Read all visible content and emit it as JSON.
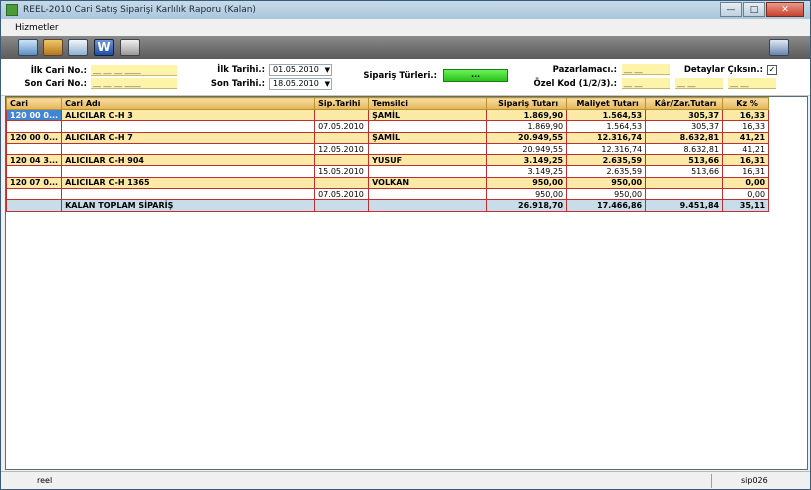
{
  "window": {
    "title": "REEL-2010 Cari Satış Siparişi Karlılık Raporu (Kalan)"
  },
  "menu": {
    "items": [
      "Hizmetler"
    ]
  },
  "toolbar": {
    "icons": [
      "monitor-icon",
      "notebook-icon",
      "mail-icon",
      "word-icon",
      "printer-icon",
      "exit-door-icon"
    ]
  },
  "filters": {
    "ilk_cari_label": "İlk Cari No.:",
    "son_cari_label": "Son Cari No.:",
    "cari_placeholder": "__ __ __ ____",
    "ilk_tarih_label": "İlk Tarihi.:",
    "son_tarih_label": "Son Tarihi.:",
    "ilk_tarih": "01.05.2010",
    "son_tarih": "18.05.2010",
    "siparis_turleri_label": "Sipariş Türleri.:",
    "siparis_turleri_button": "...",
    "pazarlamaci_label": "Pazarlamacı.:",
    "ozel_kod_label": "Özel Kod (1/2/3).:",
    "short_placeholder": "__ __",
    "detaylar_label": "Detaylar Çıksın.:",
    "detaylar_checked": "✓"
  },
  "grid": {
    "columns": [
      "Cari",
      "Cari Adı",
      "Sip.Tarihi",
      "Temsilci",
      "Sipariş Tutarı",
      "Maliyet Tutarı",
      "Kâr/Zar.Tutarı",
      "Kz %"
    ],
    "rows": [
      {
        "type": "grp",
        "sel": true,
        "cells": [
          "120 00 0...",
          "ALICILAR C-H 3",
          "",
          "ŞAMİL",
          "1.869,90",
          "1.564,53",
          "305,37",
          "16,33"
        ]
      },
      {
        "type": "det",
        "cells": [
          "",
          "",
          "07.05.2010",
          "",
          "1.869,90",
          "1.564,53",
          "305,37",
          "16,33"
        ]
      },
      {
        "type": "grp",
        "cells": [
          "120 00 0...",
          "ALICILAR C-H 7",
          "",
          "ŞAMİL",
          "20.949,55",
          "12.316,74",
          "8.632,81",
          "41,21"
        ]
      },
      {
        "type": "det",
        "cells": [
          "",
          "",
          "12.05.2010",
          "",
          "20.949,55",
          "12.316,74",
          "8.632,81",
          "41,21"
        ]
      },
      {
        "type": "grp",
        "cells": [
          "120 04 3...",
          "ALICILAR C-H 904",
          "",
          "YUSUF",
          "3.149,25",
          "2.635,59",
          "513,66",
          "16,31"
        ]
      },
      {
        "type": "det",
        "cells": [
          "",
          "",
          "15.05.2010",
          "",
          "3.149,25",
          "2.635,59",
          "513,66",
          "16,31"
        ]
      },
      {
        "type": "grp",
        "cells": [
          "120 07 0...",
          "ALICILAR C-H 1365",
          "",
          "VOLKAN",
          "950,00",
          "950,00",
          "",
          "0,00"
        ]
      },
      {
        "type": "det",
        "cells": [
          "",
          "",
          "07.05.2010",
          "",
          "950,00",
          "950,00",
          "",
          "0,00"
        ]
      },
      {
        "type": "tot",
        "cells": [
          "",
          "KALAN TOPLAM SİPARİŞ",
          "",
          "",
          "26.918,70",
          "17.466,86",
          "9.451,84",
          "35,11"
        ]
      }
    ]
  },
  "status": {
    "left": "reel",
    "right": "sip026"
  },
  "colors": {
    "header_gradient_top": "#f6dfa0",
    "group_row": "#fbeaa5",
    "total_row": "#c8dde9",
    "selection": "#3f86d6",
    "button_green": "#27c31a"
  }
}
